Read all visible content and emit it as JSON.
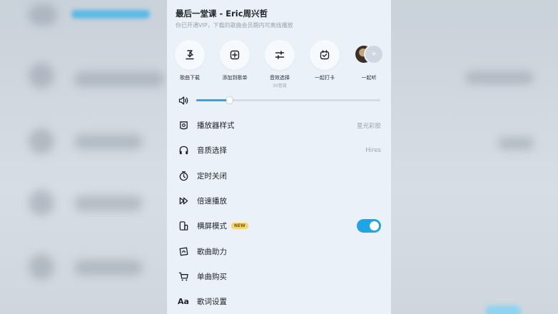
{
  "header": {
    "title": "最后一堂课 - Eric周兴哲",
    "subtitle": "你已开通VIP，下载的歌曲会员期内可离线播放"
  },
  "actions": [
    {
      "label": "歌曲下载",
      "icon": "download-icon"
    },
    {
      "label": "添加到歌单",
      "icon": "add-to-playlist-icon"
    },
    {
      "label": "音效选择",
      "sublabel": "30音效",
      "icon": "equalizer-icon"
    },
    {
      "label": "一起打卡",
      "icon": "check-in-icon"
    },
    {
      "label": "一起听",
      "icon": "listen-together-icon"
    }
  ],
  "volume": {
    "level": 0.18
  },
  "menu": [
    {
      "label": "播放器样式",
      "value": "星光彩胶",
      "icon": "player-style-icon"
    },
    {
      "label": "音质选择",
      "value": "Hires",
      "icon": "headphones-icon"
    },
    {
      "label": "定时关闭",
      "icon": "timer-icon"
    },
    {
      "label": "倍速播放",
      "icon": "speed-icon"
    },
    {
      "label": "横屏模式",
      "badge": "NEW",
      "toggle": true,
      "icon": "landscape-icon"
    },
    {
      "label": "歌曲助力",
      "icon": "boost-icon"
    },
    {
      "label": "单曲购买",
      "icon": "cart-icon"
    },
    {
      "label": "歌词设置",
      "icon_text": "Aa",
      "icon": "lyrics-icon"
    }
  ],
  "colors": {
    "accent": "#1fa4e6",
    "sheet": "#eaf1f8",
    "badge": "#f5d76e"
  }
}
